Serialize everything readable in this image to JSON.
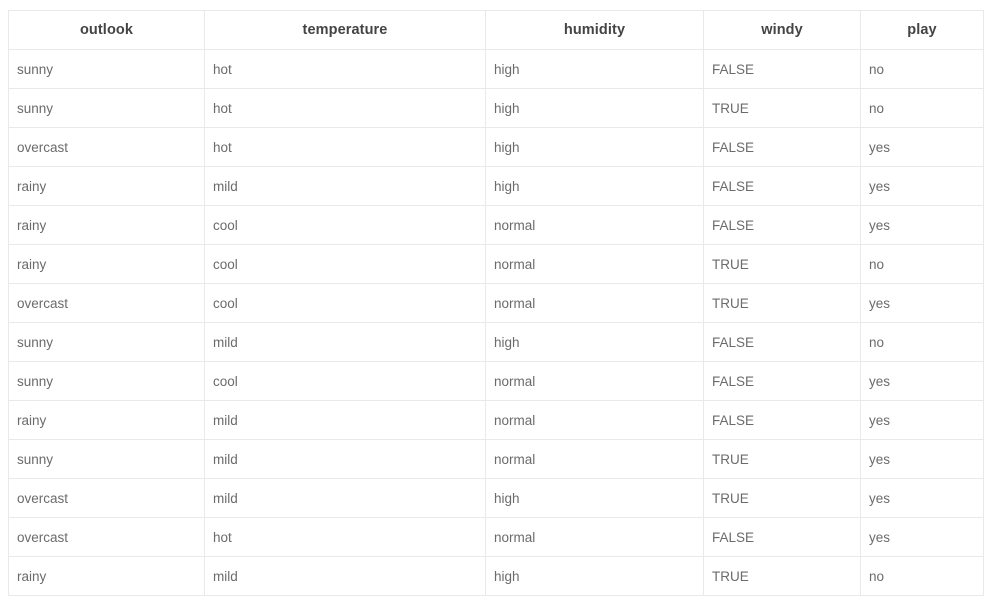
{
  "table": {
    "columns": [
      {
        "key": "outlook",
        "label": "outlook"
      },
      {
        "key": "temperature",
        "label": "temperature"
      },
      {
        "key": "humidity",
        "label": "humidity"
      },
      {
        "key": "windy",
        "label": "windy"
      },
      {
        "key": "play",
        "label": "play"
      }
    ],
    "rows": [
      [
        "sunny",
        "hot",
        "high",
        "FALSE",
        "no"
      ],
      [
        "sunny",
        "hot",
        "high",
        "TRUE",
        "no"
      ],
      [
        "overcast",
        "hot",
        "high",
        "FALSE",
        "yes"
      ],
      [
        "rainy",
        "mild",
        "high",
        "FALSE",
        "yes"
      ],
      [
        "rainy",
        "cool",
        "normal",
        "FALSE",
        "yes"
      ],
      [
        "rainy",
        "cool",
        "normal",
        "TRUE",
        "no"
      ],
      [
        "overcast",
        "cool",
        "normal",
        "TRUE",
        "yes"
      ],
      [
        "sunny",
        "mild",
        "high",
        "FALSE",
        "no"
      ],
      [
        "sunny",
        "cool",
        "normal",
        "FALSE",
        "yes"
      ],
      [
        "rainy",
        "mild",
        "normal",
        "FALSE",
        "yes"
      ],
      [
        "sunny",
        "mild",
        "normal",
        "TRUE",
        "yes"
      ],
      [
        "overcast",
        "mild",
        "high",
        "TRUE",
        "yes"
      ],
      [
        "overcast",
        "hot",
        "normal",
        "FALSE",
        "yes"
      ],
      [
        "rainy",
        "mild",
        "high",
        "TRUE",
        "no"
      ]
    ],
    "colors": {
      "header_text": "#444444",
      "cell_text": "#6b6b6b",
      "border": "#e9e9e9",
      "background": "#ffffff"
    }
  }
}
